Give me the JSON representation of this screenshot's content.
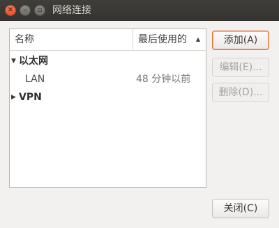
{
  "window": {
    "title": "网络连接"
  },
  "list": {
    "columns": {
      "name": "名称",
      "last_used": "最后使用的"
    },
    "groups": [
      {
        "label": "以太网",
        "expanded": true,
        "connections": [
          {
            "name": "LAN",
            "last_used": "48 分钟以前"
          }
        ]
      },
      {
        "label": "VPN",
        "expanded": false,
        "connections": []
      }
    ]
  },
  "buttons": {
    "add": "添加(A)",
    "edit": "编辑(E)...",
    "delete": "删除(D)...",
    "close": "关闭(C)"
  },
  "colors": {
    "titlebar": "#3c3b37",
    "accent": "#e9702f",
    "close_button": "#e95420"
  }
}
